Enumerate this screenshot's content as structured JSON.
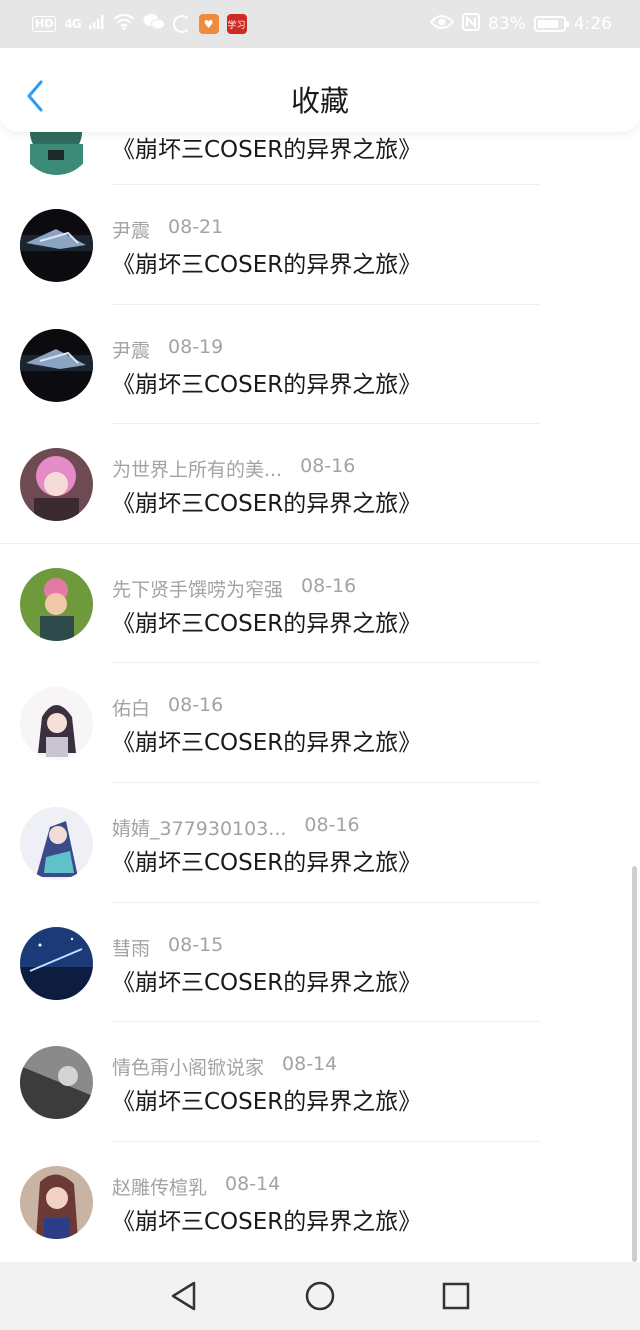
{
  "status_bar": {
    "hd": "HD",
    "signal": "4G",
    "app1": "♥",
    "app2": "学习",
    "battery": "83%",
    "time": "4:26"
  },
  "header": {
    "title": "收藏"
  },
  "items": [
    {
      "author": "",
      "date": "",
      "title": "《崩坏三COSER的异界之旅》"
    },
    {
      "author": "尹震",
      "date": "08-21",
      "title": "《崩坏三COSER的异界之旅》"
    },
    {
      "author": "尹震",
      "date": "08-19",
      "title": "《崩坏三COSER的异界之旅》"
    },
    {
      "author": "为世界上所有的美...",
      "date": "08-16",
      "title": "《崩坏三COSER的异界之旅》"
    },
    {
      "author": "先下贤手馔唠为窄强",
      "date": "08-16",
      "title": "《崩坏三COSER的异界之旅》"
    },
    {
      "author": "佑白",
      "date": "08-16",
      "title": "《崩坏三COSER的异界之旅》"
    },
    {
      "author": "婧婧_377930103...",
      "date": "08-16",
      "title": "《崩坏三COSER的异界之旅》"
    },
    {
      "author": "彗雨",
      "date": "08-15",
      "title": "《崩坏三COSER的异界之旅》"
    },
    {
      "author": "情色甭小阁锨说家",
      "date": "08-14",
      "title": "《崩坏三COSER的异界之旅》"
    },
    {
      "author": "赵雕传楦乳",
      "date": "08-14",
      "title": "《崩坏三COSER的异界之旅》"
    }
  ],
  "colors": {
    "accent": "#2d9cf0",
    "meta_text": "#a3a3a3",
    "title_text": "#1a1a1a"
  }
}
